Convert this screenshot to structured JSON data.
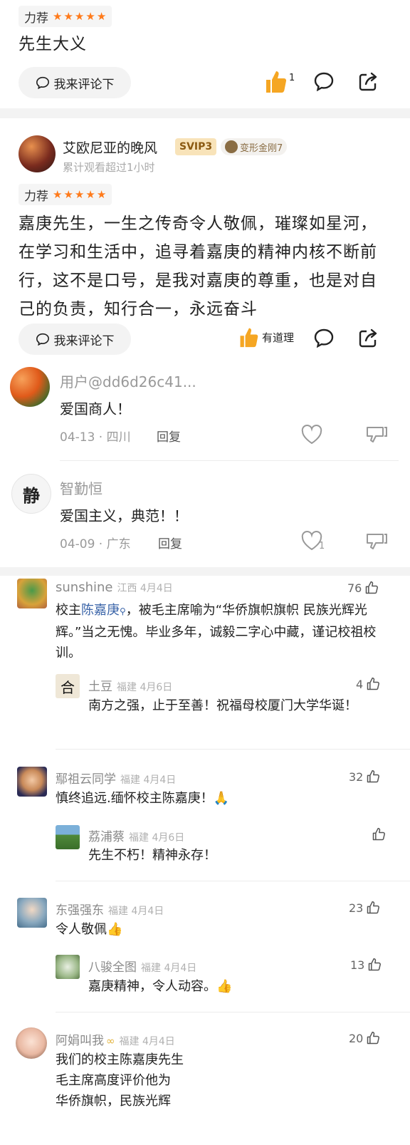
{
  "card1": {
    "rating_label": "力荐",
    "text": "先生大义",
    "comment_btn": "我来评论下",
    "like_count": "1"
  },
  "card2": {
    "username": "艾欧尼亚的晚风",
    "svip": "SVIP3",
    "medal": "变形金刚7",
    "sub": "累计观看超过1小时",
    "rating_label": "力荐",
    "text": "嘉庚先生，一生之传奇令人敬佩，璀璨如星河，在学习和生活中，追寻着嘉庚的精神内核不断前行，这不是口号，是我对嘉庚的尊重，也是对自己的负责，知行合一，永远奋斗",
    "comment_btn": "我来评论下",
    "like_label": "有道理"
  },
  "replies": [
    {
      "name": "用户@dd6d26c41...",
      "text": "爱国商人！",
      "meta": "04-13 · 四川",
      "reply": "回复",
      "avatar_char": "",
      "like_count": ""
    },
    {
      "name": "智勤恒",
      "text": "爱国主义，典范！！",
      "meta": "04-09 · 广东",
      "reply": "回复",
      "avatar_char": "静",
      "like_count": "1"
    }
  ],
  "comments": {
    "c1": {
      "name": "sunshine",
      "loc": "江西  4月4日",
      "likes": "76",
      "text_pre": "校主",
      "text_link": "陈嘉庚",
      "text_post": "，被毛主席喻为“华侨旗帜旗帜 民族光辉光辉。”当之无愧。毕业多年，诚毅二字心中藏，谨记校祖校训。"
    },
    "c1r": {
      "name": "土豆",
      "loc": "福建  4月6日",
      "likes": "4",
      "text": "南方之强，止于至善！祝福母校厦门大学华诞！",
      "avatar_char": "合"
    },
    "c2": {
      "name": "鄢祖云同学",
      "loc": "福建  4月4日",
      "likes": "32",
      "text": "慎终追远.缅怀校主陈嘉庚！🙏"
    },
    "c2r": {
      "name": "荔浦蔡",
      "loc": "福建  4月6日",
      "likes": "",
      "text": "先生不朽！精神永存！"
    },
    "c3": {
      "name": "东强强东",
      "loc": "福建  4月4日",
      "likes": "23",
      "text": "令人敬佩👍"
    },
    "c3r": {
      "name": "八骏全图",
      "loc": "福建  4月4日",
      "likes": "13",
      "text": "嘉庚精神，令人动容。👍"
    },
    "c4": {
      "name": "阿娟叫我",
      "loc": "福建  4月4日",
      "likes": "20",
      "text1": "我们的校主陈嘉庚先生",
      "text2": "毛主席高度评价他为",
      "text3": "华侨旗帜，民族光辉"
    }
  },
  "colors": {
    "star": "#ff7a1a",
    "like": "#f5a623",
    "link": "#3a64a8"
  }
}
